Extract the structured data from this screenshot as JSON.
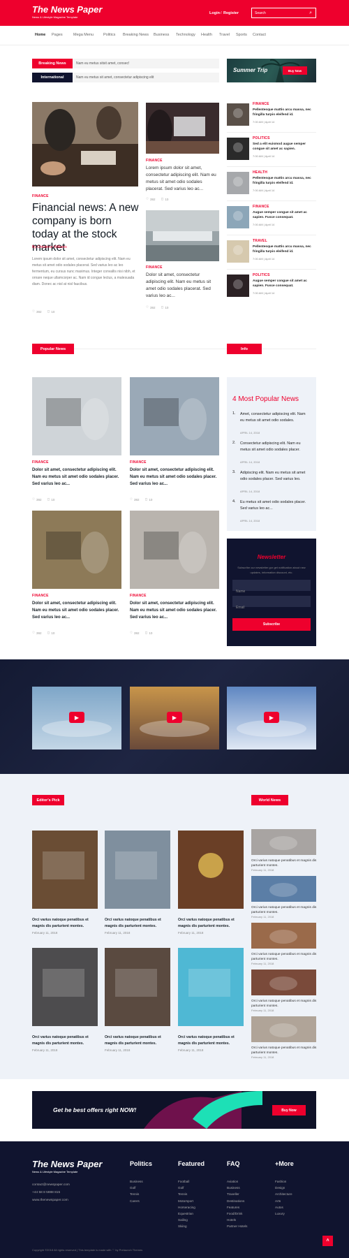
{
  "header": {
    "logo": "The News Paper",
    "tagline": "News & Lifestyle Magazine Template",
    "login": "Login",
    "divider": "/",
    "register": "Register",
    "search_placeholder": "Search"
  },
  "nav": {
    "items": [
      "Home",
      "Pages",
      "Mega Menu",
      "Politics",
      "Breaking News",
      "Business",
      "Technology",
      "Health",
      "Travel",
      "Sports",
      "Contact"
    ]
  },
  "ticker": {
    "breaking_label": "Breaking News",
    "breaking_text": "Nam eu metus sitsit amet, consec!",
    "intl_label": "International",
    "intl_text": "Nam eu metus sit amet, consectetur adipiscing elit"
  },
  "promo": {
    "title": "Summer Trip",
    "button": "Buy Now"
  },
  "featured": {
    "category": "FINANCE",
    "headline": "Financial news: A new company is born today at the stock market",
    "author": "By Christinne Williams",
    "body": "Lorem ipsum dolor sit amet, consectetur adipiscing elit. Nam eu metus sit amet odio sodales placerat. Sed varius leo ac leo fermentum, eu cursus nunc maximus. Integer convallis nisi nibh, et ornare neque ullamcorper ac. Nam id congue lectus, a malesuada diam. Donec ac nisl at nisl faucibus.",
    "likes": "392",
    "comments": "10"
  },
  "middle_articles": [
    {
      "category": "FINANCE",
      "text": "Lorem ipsum dolor sit amet, consectetur adipiscing elit. Nam eu metus sit amet odio sodales placerat. Sed varius leo ac...",
      "likes": "392",
      "comments": "10"
    },
    {
      "category": "FINANCE",
      "text": "Dolor sit amet, consectetur adipiscing elit. Nam eu metus sit amet odio sodales placerat. Sed varius leo ac...",
      "likes": "392",
      "comments": "10"
    }
  ],
  "sidebar_news": [
    {
      "category": "FINANCE",
      "title": "Pellentesque mattis arcu massa, nec fringilla turpis eleifend id.",
      "date": "7:00 AM | April 14"
    },
    {
      "category": "POLITICS",
      "title": "Sed a elit euismod augue semper congue sit amet ac sapien.",
      "date": "7:00 AM | April 14"
    },
    {
      "category": "HEALTH",
      "title": "Pellentesque mattis arcu massa, nec fringilla turpis eleifend id.",
      "date": "7:00 AM | April 14"
    },
    {
      "category": "FINANCE",
      "title": "Augue semper congue sit amet ac sapien. Fusce consequat.",
      "date": "7:00 AM | April 14"
    },
    {
      "category": "TRAVEL",
      "title": "Pellentesque mattis arcu massa, nec fringilla turpis eleifend id.",
      "date": "7:00 AM | April 14"
    },
    {
      "category": "POLITICS",
      "title": "Augue semper congue sit amet ac sapien. Fusce consequat.",
      "date": "7:00 AM | April 14"
    }
  ],
  "popular": {
    "heading": "Popular News",
    "info": "Info",
    "cards": [
      {
        "category": "FINANCE",
        "title": "Dolor sit amet, consectetur adipiscing elit. Nam eu metus sit amet odio sodales placer. Sed varius leo ac...",
        "likes": "392",
        "comments": "10"
      },
      {
        "category": "FINANCE",
        "title": "Dolor sit amet, consectetur adipiscing elit. Nam eu metus sit amet odio sodales placer. Sed varius leo ac...",
        "likes": "392",
        "comments": "10"
      },
      {
        "category": "FINANCE",
        "title": "Dolor sit amet, consectetur adipiscing elit. Nam eu metus sit amet odio sodales placer. Sed varius leo ac...",
        "likes": "392",
        "comments": "10"
      },
      {
        "category": "FINANCE",
        "title": "Dolor sit amet, consectetur adipiscing elit. Nam eu metus sit amet odio sodales placer. Sed varius leo ac...",
        "likes": "392",
        "comments": "10"
      }
    ]
  },
  "most_popular": {
    "title": "4 Most Popular News",
    "items": [
      {
        "num": "1.",
        "text": "Amet, consectetur adipiscing elit. Nam eu metus sit amet odio sodales.",
        "date": "APRIL 14, 2018"
      },
      {
        "num": "2.",
        "text": "Consectetur adipiscing elit. Nam eu metus sit amet odio sodales placer.",
        "date": "APRIL 14, 2018"
      },
      {
        "num": "3.",
        "text": "Adipiscing elit. Nam eu metus sit amet odio sodales placer. Sed varius leo.",
        "date": "APRIL 14, 2018"
      },
      {
        "num": "4.",
        "text": "Eu metus sit amet odio sodales placer. Sed varius leo ac...",
        "date": "APRIL 14, 2018"
      }
    ]
  },
  "newsletter": {
    "title": "Newsletter",
    "desc": "Subscribe our newsletter gor get notification about new updates, information discount, etc.",
    "name_placeholder": "Name",
    "email_placeholder": "Email",
    "button": "Subscribe"
  },
  "editors": {
    "heading": "Editor's Pick",
    "world": "World News",
    "cards": [
      {
        "title": "Orci varius natoque penatibus et magnis dis parturient montes.",
        "date": "February 11, 2018"
      },
      {
        "title": "Orci varius natoque penatibus et magnis dis parturient montes.",
        "date": "February 11, 2018"
      },
      {
        "title": "Orci varius natoque penatibus et magnis dis parturient montes.",
        "date": "February 11, 2018"
      },
      {
        "title": "Orci varius natoque penatibus et magnis dis parturient montes.",
        "date": "February 11, 2018"
      },
      {
        "title": "Orci varius natoque penatibus et magnis dis parturient montes.",
        "date": "February 11, 2018"
      },
      {
        "title": "Orci varius natoque penatibus et magnis dis parturient montes.",
        "date": "February 11, 2018"
      }
    ],
    "world_items": [
      {
        "title": "Orci varius natoque penatibus et magnis dis parturient montes.",
        "date": "February 11, 2018"
      },
      {
        "title": "Orci varius natoque penatibus et magnis dis parturient montes.",
        "date": "February 11, 2018"
      },
      {
        "title": "Orci varius natoque penatibus et magnis dis parturient montes.",
        "date": "February 11, 2018"
      },
      {
        "title": "Orci varius natoque penatibus et magnis dis parturient montes.",
        "date": "February 11, 2018"
      },
      {
        "title": "Orci varius natoque penatibus et magnis dis parturient montes.",
        "date": "February 11, 2018"
      }
    ]
  },
  "offer": {
    "text": "Get he best offers right NOW!",
    "button": "Buy Now"
  },
  "footer": {
    "logo": "The News Paper",
    "tagline": "News & Lifestyle Magazine Template",
    "contact": [
      "contact@newspaper.com",
      "+44 58 8 5988 815",
      "www.thenewspaper.com"
    ],
    "cols": [
      {
        "title": "Politics",
        "items": [
          "Business",
          "Golf",
          "Tennis",
          "Carers"
        ]
      },
      {
        "title": "Featured",
        "items": [
          "Football",
          "Golf",
          "Tennis",
          "Motorsport",
          "Horseracing",
          "Equestrian",
          "Sailing",
          "Skiing"
        ]
      },
      {
        "title": "FAQ",
        "items": [
          "Aviation",
          "Business",
          "Traveller",
          "Destinations",
          "Features",
          "Food/Drink",
          "Hotels",
          "Partner Hotels"
        ]
      },
      {
        "title": "+More",
        "items": [
          "Fashion",
          "Design",
          "Architecture",
          "Arts",
          "Autos",
          "Luxury"
        ]
      }
    ],
    "copyright": "Copyright ©2018 All rights reserved | This template is made with ♡ by Prelaunch Themes"
  }
}
